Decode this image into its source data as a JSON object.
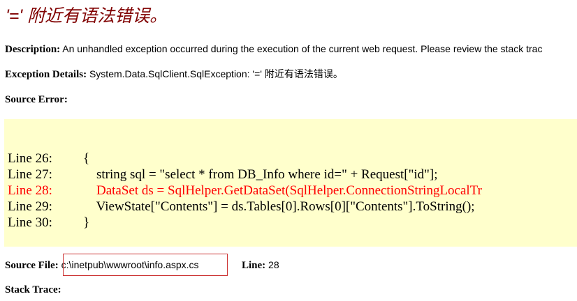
{
  "title": "'=' 附近有语法错误。",
  "description": {
    "label": "Description:",
    "text": " An unhandled exception occurred during the execution of the current web request. Please review the stack trac"
  },
  "exception": {
    "label": "Exception Details:",
    "text": " System.Data.SqlClient.SqlException: '=' 附近有语法错误。"
  },
  "source_error": {
    "label": "Source Error:"
  },
  "code": {
    "lines": [
      {
        "num": "Line 26:",
        "code": "{"
      },
      {
        "num": "Line 27:",
        "code": "    string sql = \"select * from DB_Info where id=\" + Request[\"id\"];"
      },
      {
        "num": "Line 28:",
        "code": "    DataSet ds = SqlHelper.GetDataSet(SqlHelper.ConnectionStringLocalTr"
      },
      {
        "num": "Line 29:",
        "code": "    ViewState[\"Contents\"] = ds.Tables[0].Rows[0][\"Contents\"].ToString();"
      },
      {
        "num": "Line 30:",
        "code": "}"
      }
    ],
    "highlight_color": "#ff0000",
    "background": "#ffffcc"
  },
  "source_file": {
    "label": "Source File:",
    "path": " c:\\inetpub\\wwwroot\\info.aspx.cs",
    "line_label": "Line:",
    "line_value": " 28"
  },
  "stack_trace": {
    "label": "Stack Trace:"
  },
  "colors": {
    "title": "#800000",
    "annotation_box": "#cc3333"
  }
}
